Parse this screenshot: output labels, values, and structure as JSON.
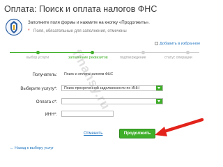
{
  "page": {
    "title": "Оплата: Поиск и оплата налогов ФНС",
    "hint_line1": "Заполните поля формы и нажмите на кнопку «Продолжить».",
    "hint_line2": "Поля, обязательные для заполнения, отмечены",
    "required_mark": "*",
    "favorites_label": "Добавить в избранное"
  },
  "steps": [
    {
      "label": "выбор услуги",
      "state": "done"
    },
    {
      "label": "заполнение реквизитов",
      "state": "active"
    },
    {
      "label": "подтверждение",
      "state": "pending"
    },
    {
      "label": "статус операции",
      "state": "pending"
    }
  ],
  "form": {
    "recipient_label": "Получатель:",
    "recipient_value": "Поиск и оплата налогов ФНС",
    "service_label": "Выберите услугу*:",
    "service_value": "Поиск просроченной задолженности по ИНН",
    "payment_from_label": "Оплата с*:",
    "payment_from_value": "",
    "inn_label": "ИНН*:",
    "inn_value": ""
  },
  "watermark": "finansy.ru",
  "actions": {
    "cancel_label": "Отменить",
    "submit_label": "Продолжить",
    "back_label": "← Назад к выбору услуг"
  },
  "colors": {
    "accent_green": "#3fae29",
    "link_blue": "#1e73be",
    "arrow_red": "#e3231b"
  }
}
